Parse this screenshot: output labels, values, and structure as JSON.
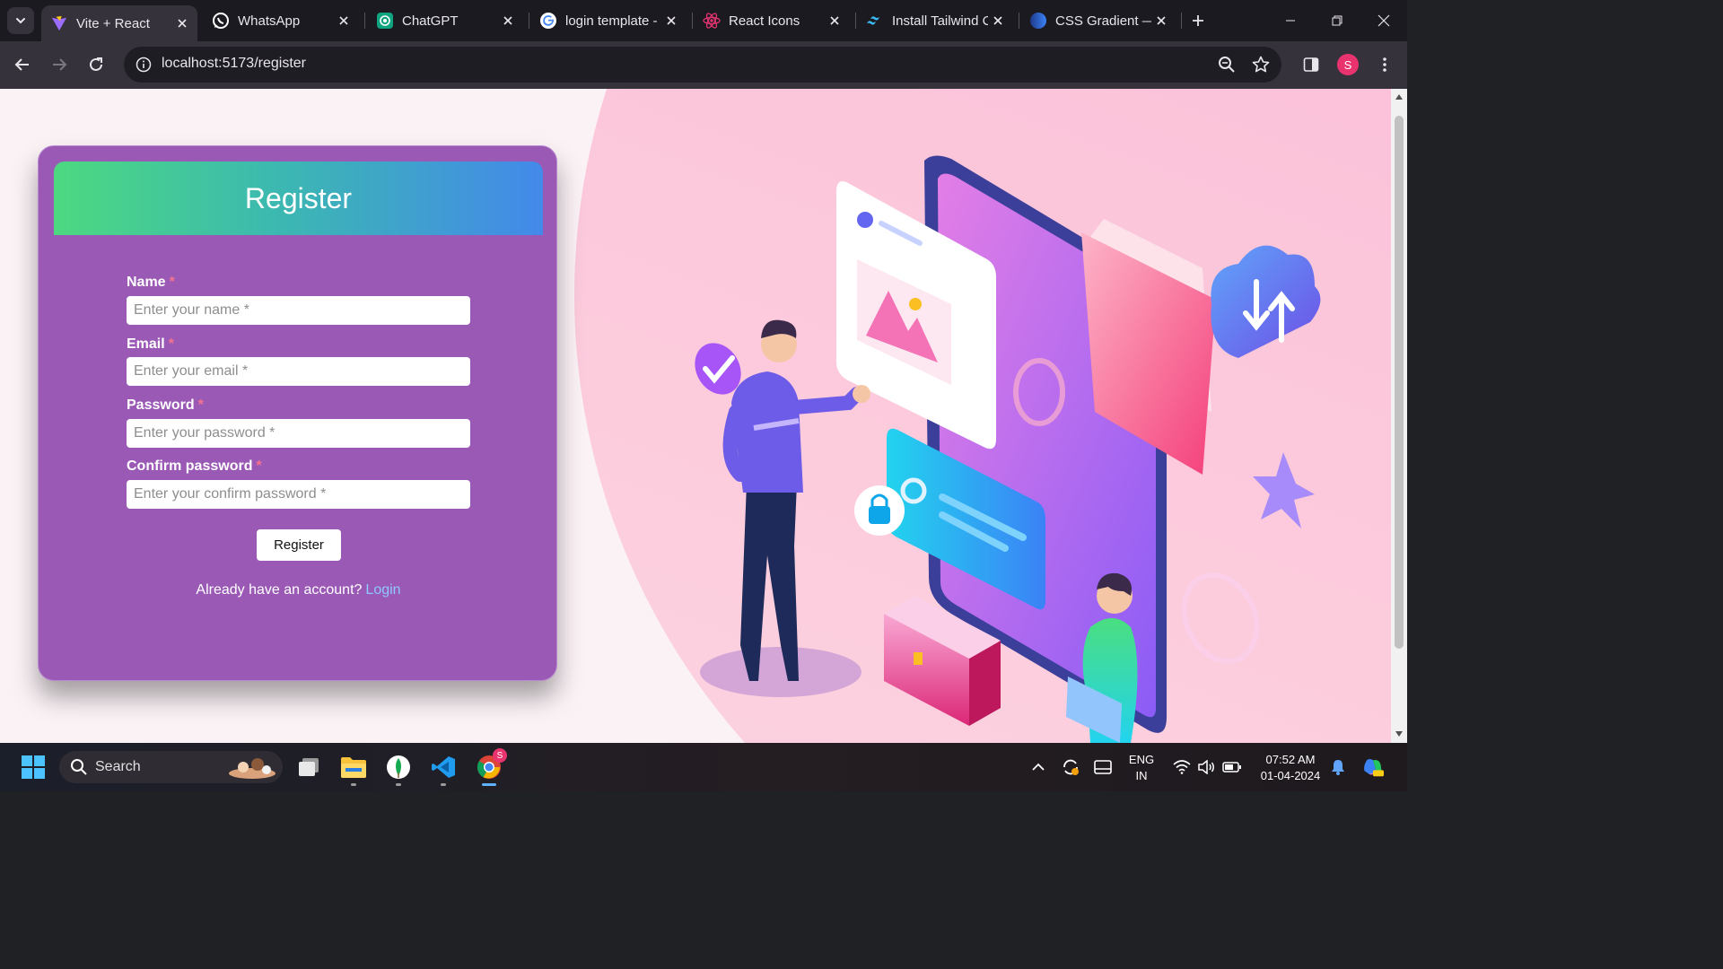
{
  "browser": {
    "tabs": [
      {
        "title": "Vite + React",
        "icon": "vite-icon",
        "active": true
      },
      {
        "title": "WhatsApp",
        "icon": "whatsapp-icon",
        "active": false
      },
      {
        "title": "ChatGPT",
        "icon": "chatgpt-icon",
        "active": false
      },
      {
        "title": "login template -",
        "icon": "google-icon",
        "active": false
      },
      {
        "title": "React Icons",
        "icon": "react-icon",
        "active": false
      },
      {
        "title": "Install Tailwind C",
        "icon": "tailwind-icon",
        "active": false
      },
      {
        "title": "CSS Gradient —",
        "icon": "css-gradient-icon",
        "active": false
      }
    ],
    "url": "localhost:5173/register",
    "profile_initial": "S"
  },
  "page": {
    "card_title": "Register",
    "fields": [
      {
        "label": "Name",
        "required_mark": "*",
        "placeholder": "Enter your name *",
        "value": ""
      },
      {
        "label": "Email",
        "required_mark": "*",
        "placeholder": "Enter your email *",
        "value": ""
      },
      {
        "label": "Password",
        "required_mark": "*",
        "placeholder": "Enter your password *",
        "value": ""
      },
      {
        "label": "Confirm password",
        "required_mark": "*",
        "placeholder": "Enter your confirm password *",
        "value": ""
      }
    ],
    "submit_label": "Register",
    "login_prompt": "Already have an account?",
    "login_link": "Login"
  },
  "colors": {
    "card": "#9b59b6",
    "header_gradient_start": "#4cd980",
    "header_gradient_end": "#4389ea",
    "required": "#f4728d",
    "link": "#8ec8ff"
  },
  "taskbar": {
    "search_label": "Search",
    "language": "ENG",
    "region": "IN",
    "time": "07:52 AM",
    "date": "01-04-2024",
    "chrome_badge": "S"
  }
}
